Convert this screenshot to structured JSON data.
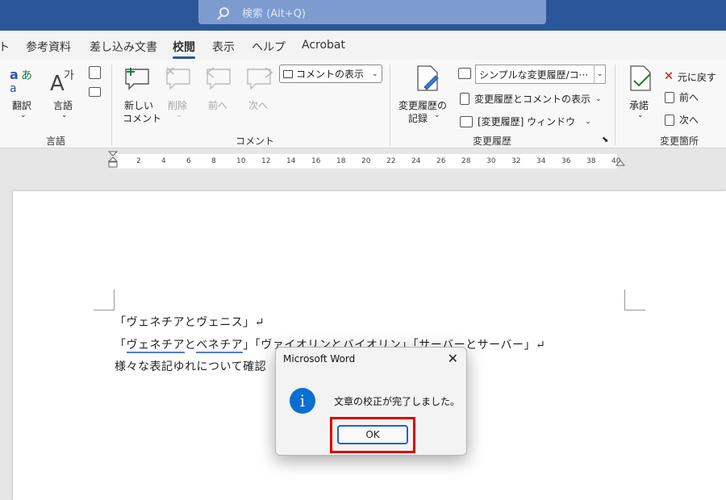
{
  "search": {
    "placeholder": "検索 (Alt+Q)"
  },
  "tabs": [
    "ト",
    "参考資料",
    "差し込み文書",
    "校閲",
    "表示",
    "ヘルプ",
    "Acrobat"
  ],
  "ribbon": {
    "translate_label": "翻訳",
    "language_label": "言語",
    "language_group": "言語",
    "new_comment_line1": "新しい",
    "new_comment_line2": "コメント",
    "delete_label": "削除",
    "prev_label": "前へ",
    "next_label": "次へ",
    "show_comments": "コメントの表示",
    "comment_group": "コメント",
    "track_changes_line1": "変更履歴の",
    "track_changes_line2": "記録",
    "display_mode": "シンプルな変更履歴/コ···",
    "show_markup": "変更履歴とコメントの表示",
    "reviewing_pane": "[変更履歴] ウィンドウ",
    "tracking_group": "変更履歴",
    "accept_label": "承諾",
    "reject_label": "元に戻す",
    "prev_change": "前へ",
    "next_change": "次へ",
    "changes_group": "変更箇所"
  },
  "ruler": {
    "ticks": [
      "2",
      "4",
      "6",
      "8",
      "10",
      "12",
      "14",
      "16",
      "18",
      "20",
      "22",
      "24",
      "26",
      "28",
      "30",
      "32",
      "34",
      "36",
      "38",
      "40"
    ]
  },
  "document": {
    "line1": "「ヴェネチアとヴェニス」↵",
    "line2_a": "「",
    "line2_b": "ヴェネチア",
    "line2_c": "と",
    "line2_d": "ベネチア",
    "line2_e": "」「ヴァイオリンとバイオリン」「サーバーとサーバー」↵",
    "line3": "様々な表記ゆれについて確認"
  },
  "dialog": {
    "title": "Microsoft Word",
    "message": "文章の校正が完了しました。",
    "ok": "OK",
    "info_glyph": "i",
    "close_glyph": "✕"
  }
}
